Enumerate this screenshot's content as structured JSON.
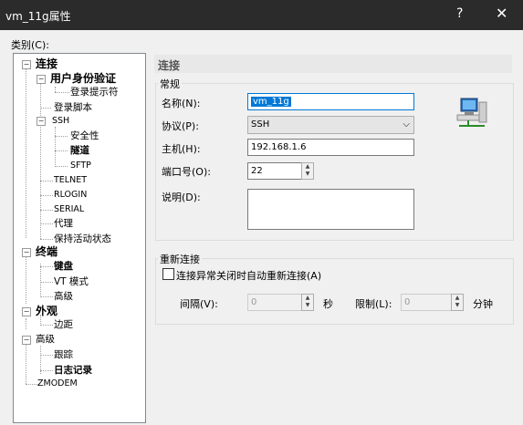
{
  "window": {
    "title": "vm_11g属性",
    "help": "?",
    "close": "✕"
  },
  "category_label": "类别(C):",
  "tree": [
    {
      "label": "连接",
      "bold": true
    },
    {
      "label": "用户身份验证",
      "bold": true
    },
    {
      "label": "登录提示符",
      "bold": false
    },
    {
      "label": "登录脚本",
      "bold": false
    },
    {
      "label": "SSH",
      "bold": false
    },
    {
      "label": "安全性",
      "bold": false
    },
    {
      "label": "隧道",
      "bold": true
    },
    {
      "label": "SFTP",
      "bold": false
    },
    {
      "label": "TELNET",
      "bold": false
    },
    {
      "label": "RLOGIN",
      "bold": false
    },
    {
      "label": "SERIAL",
      "bold": false
    },
    {
      "label": "代理",
      "bold": false
    },
    {
      "label": "保持活动状态",
      "bold": false
    },
    {
      "label": "终端",
      "bold": true
    },
    {
      "label": "键盘",
      "bold": true
    },
    {
      "label": "VT 模式",
      "bold": false
    },
    {
      "label": "高级",
      "bold": false
    },
    {
      "label": "外观",
      "bold": true
    },
    {
      "label": "边距",
      "bold": false
    },
    {
      "label": "高级",
      "bold": false
    },
    {
      "label": "跟踪",
      "bold": false
    },
    {
      "label": "日志记录",
      "bold": true
    },
    {
      "label": "ZMODEM",
      "bold": false
    }
  ],
  "panel": {
    "header": "连接",
    "general": {
      "title": "常规",
      "name_label": "名称(N):",
      "name_value": "vm_11g",
      "protocol_label": "协议(P):",
      "protocol_value": "SSH",
      "host_label": "主机(H):",
      "host_value": "192.168.1.6",
      "port_label": "端口号(O):",
      "port_value": "22",
      "desc_label": "说明(D):",
      "desc_value": ""
    },
    "reconnect": {
      "title": "重新连接",
      "checkbox_label": "连接异常关闭时自动重新连接(A)",
      "interval_label": "间隔(V):",
      "interval_value": "0",
      "interval_unit": "秒",
      "limit_label": "限制(L):",
      "limit_value": "0",
      "limit_unit": "分钟"
    }
  }
}
